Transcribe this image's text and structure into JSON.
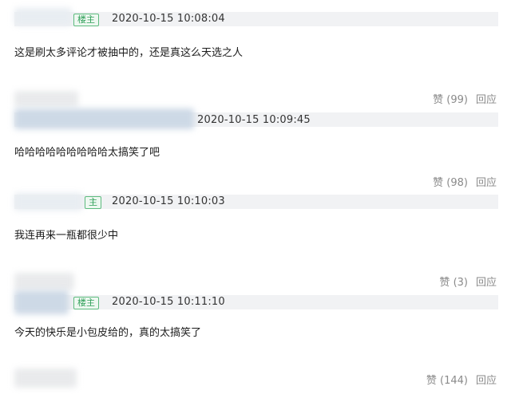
{
  "comments": [
    {
      "badge": "楼主",
      "timestamp": "2020-10-15 10:08:04",
      "text": "这是刷太多评论才被抽中的，还是真这么天选之人",
      "like_label": "赞",
      "likes": "(99)",
      "reply_label": "回应"
    },
    {
      "badge": "",
      "timestamp": "2020-10-15 10:09:45",
      "text": "哈哈哈哈哈哈哈哈哈太搞笑了吧",
      "like_label": "赞",
      "likes": "(98)",
      "reply_label": "回应"
    },
    {
      "badge": "主",
      "timestamp": "2020-10-15 10:10:03",
      "text": "我连再来一瓶都很少中",
      "like_label": "赞",
      "likes": "(3)",
      "reply_label": "回应"
    },
    {
      "badge": "楼主",
      "timestamp": "2020-10-15 10:11:10",
      "text": "今天的快乐是小包皮给的，真的太搞笑了",
      "like_label": "赞",
      "likes": "(144)",
      "reply_label": "回应"
    }
  ]
}
